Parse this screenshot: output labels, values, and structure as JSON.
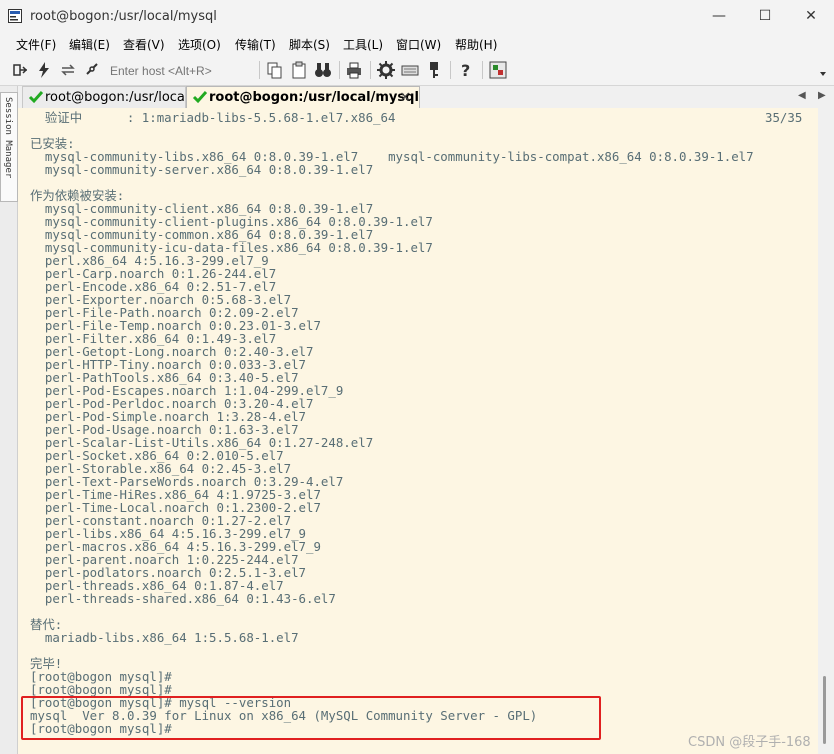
{
  "window": {
    "title": "root@bogon:/usr/local/mysql",
    "minimize": "—",
    "maximize": "☐",
    "close": "✕"
  },
  "menu": [
    "文件(F)",
    "编辑(E)",
    "查看(V)",
    "选项(O)",
    "传输(T)",
    "脚本(S)",
    "工具(L)",
    "窗口(W)",
    "帮助(H)"
  ],
  "toolbar": {
    "host_placeholder": "Enter host <Alt+R>"
  },
  "session_manager": {
    "label": "Session Manager"
  },
  "tabs": [
    {
      "label": "root@bogon:/usr/local",
      "active": false
    },
    {
      "label": "root@bogon:/usr/local/mysql",
      "active": true,
      "close": "×"
    }
  ],
  "terminal": {
    "progress": "35/35",
    "lines": [
      "  验证中      : 1:mariadb-libs-5.5.68-1.el7.x86_64",
      "",
      "已安装:",
      "  mysql-community-libs.x86_64 0:8.0.39-1.el7    mysql-community-libs-compat.x86_64 0:8.0.39-1.el7",
      "  mysql-community-server.x86_64 0:8.0.39-1.el7",
      "",
      "作为依赖被安装:",
      "  mysql-community-client.x86_64 0:8.0.39-1.el7",
      "  mysql-community-client-plugins.x86_64 0:8.0.39-1.el7",
      "  mysql-community-common.x86_64 0:8.0.39-1.el7",
      "  mysql-community-icu-data-files.x86_64 0:8.0.39-1.el7",
      "  perl.x86_64 4:5.16.3-299.el7_9",
      "  perl-Carp.noarch 0:1.26-244.el7",
      "  perl-Encode.x86_64 0:2.51-7.el7",
      "  perl-Exporter.noarch 0:5.68-3.el7",
      "  perl-File-Path.noarch 0:2.09-2.el7",
      "  perl-File-Temp.noarch 0:0.23.01-3.el7",
      "  perl-Filter.x86_64 0:1.49-3.el7",
      "  perl-Getopt-Long.noarch 0:2.40-3.el7",
      "  perl-HTTP-Tiny.noarch 0:0.033-3.el7",
      "  perl-PathTools.x86_64 0:3.40-5.el7",
      "  perl-Pod-Escapes.noarch 1:1.04-299.el7_9",
      "  perl-Pod-Perldoc.noarch 0:3.20-4.el7",
      "  perl-Pod-Simple.noarch 1:3.28-4.el7",
      "  perl-Pod-Usage.noarch 0:1.63-3.el7",
      "  perl-Scalar-List-Utils.x86_64 0:1.27-248.el7",
      "  perl-Socket.x86_64 0:2.010-5.el7",
      "  perl-Storable.x86_64 0:2.45-3.el7",
      "  perl-Text-ParseWords.noarch 0:3.29-4.el7",
      "  perl-Time-HiRes.x86_64 4:1.9725-3.el7",
      "  perl-Time-Local.noarch 0:1.2300-2.el7",
      "  perl-constant.noarch 0:1.27-2.el7",
      "  perl-libs.x86_64 4:5.16.3-299.el7_9",
      "  perl-macros.x86_64 4:5.16.3-299.el7_9",
      "  perl-parent.noarch 1:0.225-244.el7",
      "  perl-podlators.noarch 0:2.5.1-3.el7",
      "  perl-threads.x86_64 0:1.87-4.el7",
      "  perl-threads-shared.x86_64 0:1.43-6.el7",
      "",
      "替代:",
      "  mariadb-libs.x86_64 1:5.5.68-1.el7",
      "",
      "完毕!",
      "[root@bogon mysql]#",
      "[root@bogon mysql]#",
      "[root@bogon mysql]# mysql --version",
      "mysql  Ver 8.0.39 for Linux on x86_64 (MySQL Community Server - GPL)",
      "[root@bogon mysql]#"
    ]
  },
  "watermark": "CSDN @段子手-168",
  "colors": {
    "terminal_bg": "#fdf6e3",
    "terminal_fg": "#586e75",
    "highlight": "#e02020",
    "check": "#22aa22"
  }
}
